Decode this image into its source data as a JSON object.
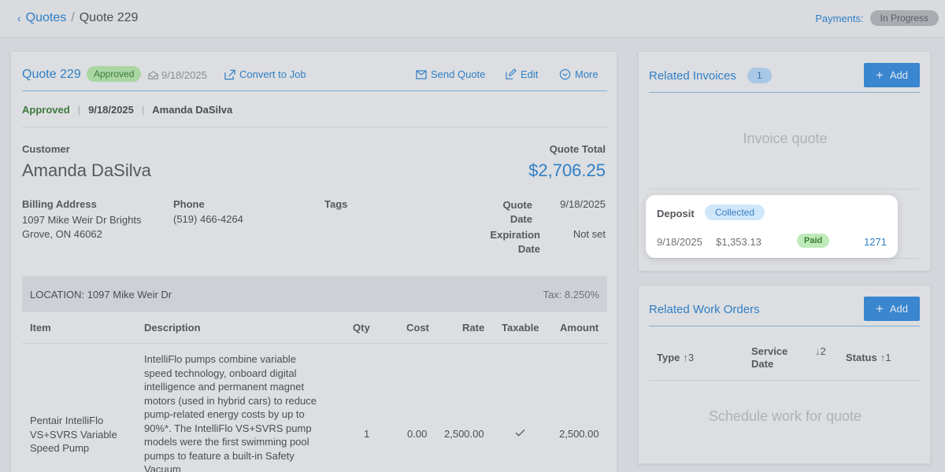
{
  "topbar": {
    "back_link": "Quotes",
    "separator": "/",
    "current": "Quote 229",
    "payments_label": "Payments:",
    "payments_status": "In Progress"
  },
  "quote": {
    "title": "Quote 229",
    "badge": "Approved",
    "header_date": "9/18/2025",
    "convert_label": "Convert to Job",
    "send_label": "Send Quote",
    "edit_label": "Edit",
    "more_label": "More",
    "status": "Approved",
    "status_date": "9/18/2025",
    "status_person": "Amanda DaSilva",
    "customer_label": "Customer",
    "customer_name": "Amanda DaSilva",
    "total_label": "Quote Total",
    "total_value": "$2,706.25",
    "billing_label": "Billing Address",
    "billing_value": "1097 Mike Weir Dr Brights Grove, ON 46062",
    "phone_label": "Phone",
    "phone_value": "(519) 466-4264",
    "tags_label": "Tags",
    "quote_date_label": "Quote Date",
    "quote_date_value": "9/18/2025",
    "expiration_label": "Expiration Date",
    "expiration_value": "Not set",
    "location": "LOCATION: 1097 Mike Weir Dr",
    "tax": "Tax: 8.250%",
    "table": {
      "headers": [
        "Item",
        "Description",
        "Qty",
        "Cost",
        "Rate",
        "Taxable",
        "Amount"
      ],
      "rows": [
        {
          "item": "Pentair IntelliFlo VS+SVRS Variable Speed Pump",
          "description": "IntelliFlo pumps combine variable speed technology, onboard digital intelligence and permanent magnet motors (used in hybrid cars) to reduce pump-related energy costs by up to 90%*. The IntelliFlo VS+SVRS pump models were the first swimming pool pumps to feature a built-in Safety Vacuum",
          "qty": "1",
          "cost": "0.00",
          "rate": "2,500.00",
          "taxable": "check-icon",
          "amount": "2,500.00"
        }
      ]
    }
  },
  "invoices": {
    "title": "Related Invoices",
    "count": "1",
    "add_label": "Add",
    "empty_text": "Invoice quote"
  },
  "deposit": {
    "label": "Deposit",
    "badge": "Collected",
    "date": "9/18/2025",
    "amount": "$1,353.13",
    "status": "Paid",
    "number": "1271"
  },
  "work_orders": {
    "title": "Related Work Orders",
    "add_label": "Add",
    "col_type": "Type",
    "col_type_sort": "3",
    "col_service": "Service Date",
    "col_service_sort": "2",
    "col_status": "Status",
    "col_status_sort": "1",
    "empty_text": "Schedule work for quote"
  },
  "colors": {
    "accent": "#2f7fc6",
    "approved": "#3e7a3b",
    "button": "#3a86cf"
  }
}
